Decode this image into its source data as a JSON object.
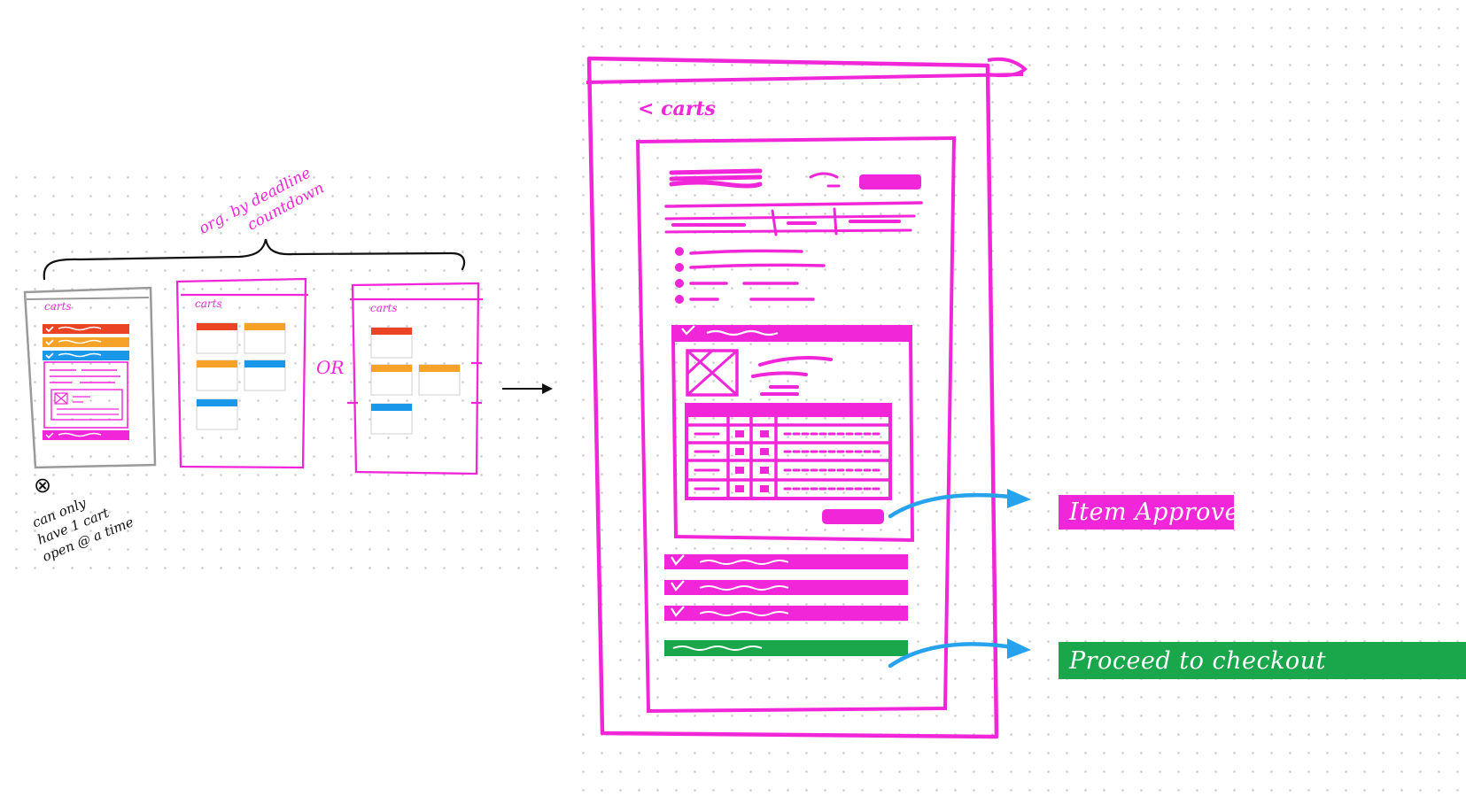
{
  "colors": {
    "magenta": "#f026d8",
    "red": "#ea4425",
    "orange": "#f6a127",
    "blue": "#1a97e9",
    "green": "#1aa64a",
    "gray": "#9a9a9a",
    "ink": "#111111",
    "arrow_blue": "#27a2ec"
  },
  "sketch": {
    "annotation_line1": "org. by deadline",
    "annotation_line2": "countdown",
    "or_label": "OR",
    "carts_label": "carts",
    "back_nav": "< carts",
    "note_symbol": "⊗",
    "note_lines": [
      "can only",
      "have 1 cart",
      "open @ a time"
    ]
  },
  "callouts": {
    "approved": "Item Approved",
    "checkout": "Proceed to checkout"
  }
}
